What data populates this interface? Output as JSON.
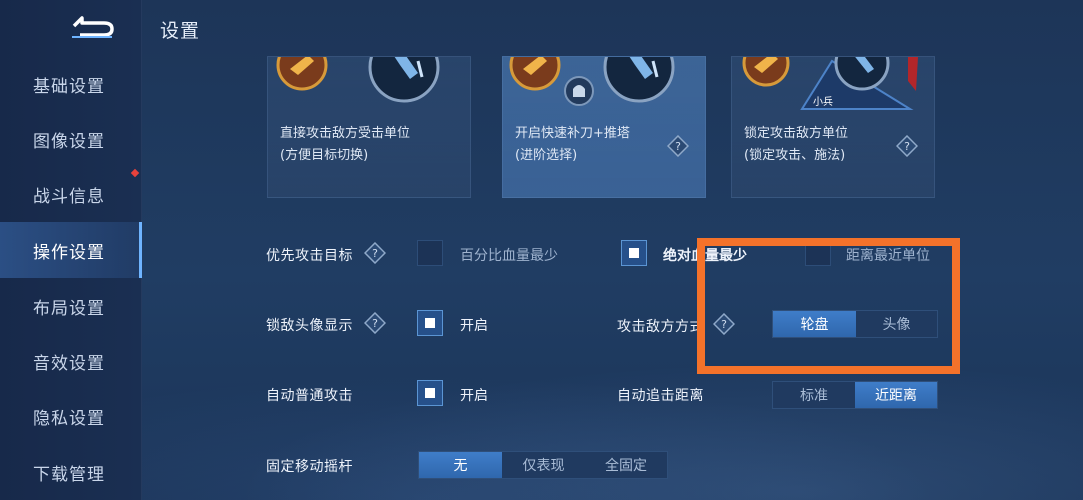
{
  "header": {
    "title": "设置"
  },
  "sidebar": {
    "items": [
      {
        "label": "基础设置"
      },
      {
        "label": "图像设置"
      },
      {
        "label": "战斗信息"
      },
      {
        "label": "操作设置"
      },
      {
        "label": "布局设置"
      },
      {
        "label": "音效设置"
      },
      {
        "label": "隐私设置"
      },
      {
        "label": "下载管理"
      }
    ],
    "active": "操作设置"
  },
  "cards": [
    {
      "line1": "直接攻击敌方受击单位",
      "line2": "(方便目标切换)",
      "selected": false
    },
    {
      "line1": "开启快速补刀+推塔",
      "line2": "(进阶选择)",
      "selected": true
    },
    {
      "line1": "锁定攻击敌方单位",
      "line2": "(锁定攻击、施法)",
      "selected": false,
      "badge": "小兵"
    }
  ],
  "settings": {
    "priority_target": {
      "label": "优先攻击目标",
      "options": [
        {
          "label": "百分比血量最少",
          "checked": false
        },
        {
          "label": "绝对血量最少",
          "checked": true
        },
        {
          "label": "距离最近单位",
          "checked": false
        }
      ]
    },
    "lock_avatar": {
      "label": "锁敌头像显示",
      "option": "开启",
      "checked": true
    },
    "attack_method": {
      "label": "攻击敌方方式",
      "segments": [
        "轮盘",
        "头像"
      ],
      "selected": "轮盘"
    },
    "auto_attack": {
      "label": "自动普通攻击",
      "option": "开启",
      "checked": true
    },
    "chase_distance": {
      "label": "自动追击距离",
      "segments": [
        "标准",
        "近距离"
      ],
      "selected": "近距离"
    },
    "joystick": {
      "label": "固定移动摇杆",
      "segments": [
        "无",
        "仅表现",
        "全固定"
      ],
      "selected": "无"
    }
  },
  "colors": {
    "accent": "#3f7dc9",
    "highlight_box": "#f4722a",
    "badge_dot": "#e8423c"
  },
  "icons": {
    "back": "back-arrow-icon",
    "help": "question-diamond-icon",
    "helmet": "helmet-icon"
  }
}
